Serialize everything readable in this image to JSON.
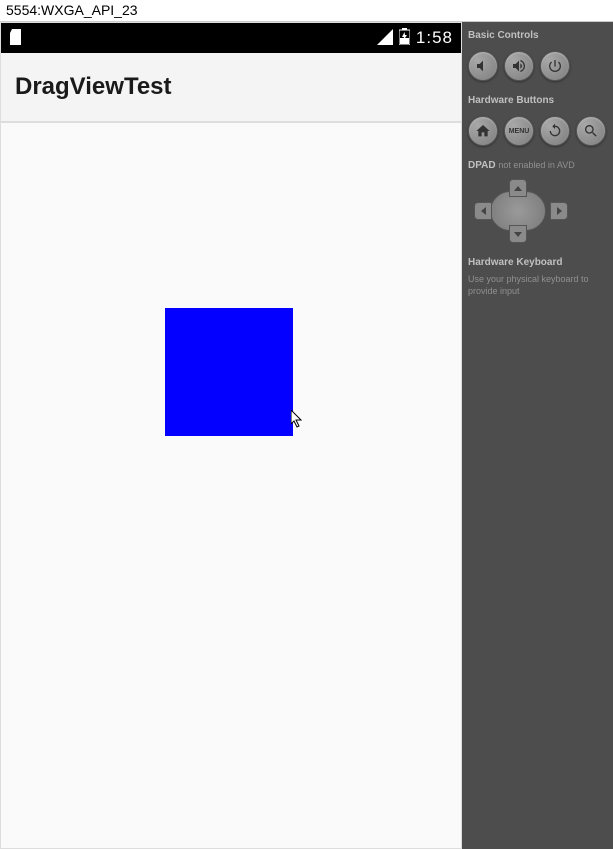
{
  "window": {
    "title": "5554:WXGA_API_23"
  },
  "status_bar": {
    "clock": "1:58"
  },
  "action_bar": {
    "title": "DragViewTest"
  },
  "side_panel": {
    "basic_controls_label": "Basic Controls",
    "hardware_buttons_label": "Hardware Buttons",
    "dpad_label": "DPAD",
    "dpad_note": "not enabled in AVD",
    "keyboard_label": "Hardware Keyboard",
    "keyboard_note": "Use your physical keyboard to provide input",
    "menu_label": "MENU"
  }
}
